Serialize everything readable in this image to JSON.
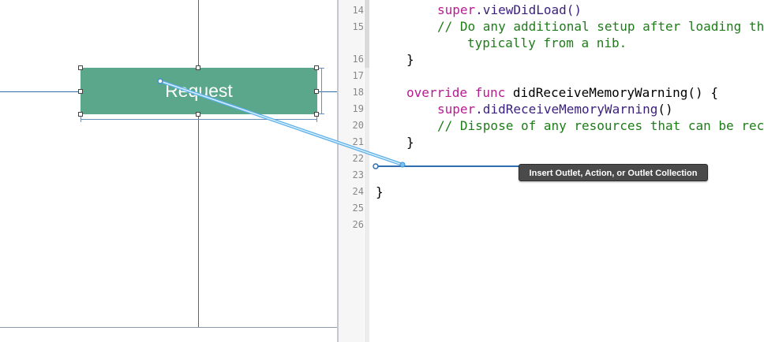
{
  "canvas": {
    "button_label": "Request"
  },
  "editor": {
    "line_numbers": [
      "14",
      "15",
      "16",
      "17",
      "18",
      "19",
      "20",
      "21",
      "22",
      "23",
      "24",
      "25",
      "26"
    ],
    "lines": {
      "l14_super": "super",
      "l14_rest": ".viewDidLoad()",
      "l15a": "// Do any additional setup after loading the",
      "l15b": "typically from a nib.",
      "l16": "}",
      "l18_kw": "override func",
      "l18_rest": " didReceiveMemoryWarning() {",
      "l19_super": "super",
      "l19_fn": ".didReceiveMemoryWarning",
      "l19_rest": "()",
      "l20": "// Dispose of any resources that can be rec",
      "l21": "}",
      "l24": "}"
    }
  },
  "connection": {
    "tooltip": "Insert Outlet, Action, or Outlet Collection"
  },
  "colors": {
    "button": "#5aa78b",
    "guide": "#2f6fb0",
    "keyword": "#b41d91",
    "comment": "#1e7c19",
    "drag_line": "#5aaee8"
  }
}
